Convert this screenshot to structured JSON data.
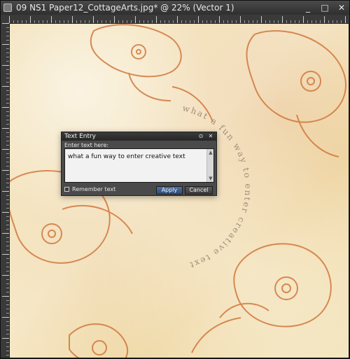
{
  "window": {
    "title": "09 NS1 Paper12_CottageArts.jpg* @ 22% (Vector 1)",
    "icons": {
      "app": "document-icon",
      "minimize": "minimize-icon",
      "maximize": "maximize-icon",
      "close": "close-icon"
    },
    "controls": {
      "minimize_glyph": "_",
      "maximize_glyph": "□",
      "close_glyph": "✕"
    }
  },
  "canvas": {
    "decor_text": "what a fun way to enter creative text"
  },
  "dialog": {
    "title": "Text Entry",
    "prompt": "Enter text here:",
    "text": "what a fun way to enter creative text",
    "remember_label": "Remember text",
    "apply_label": "Apply",
    "cancel_label": "Cancel",
    "icons": {
      "pin": "pin-icon",
      "close": "close-icon",
      "scroll_up": "scroll-up-icon",
      "scroll_down": "scroll-down-icon"
    },
    "glyphs": {
      "pin": "⊙",
      "close": "✕",
      "scroll_up": "▲",
      "scroll_down": "▼"
    }
  },
  "colors": {
    "paper_base": "#f3e1b7",
    "ink_orange": "#cc6a2c",
    "titlebar_dark": "#2f2f2f",
    "dialog_bg": "#4a4a4a",
    "apply_blue": "#2d4c7e"
  }
}
